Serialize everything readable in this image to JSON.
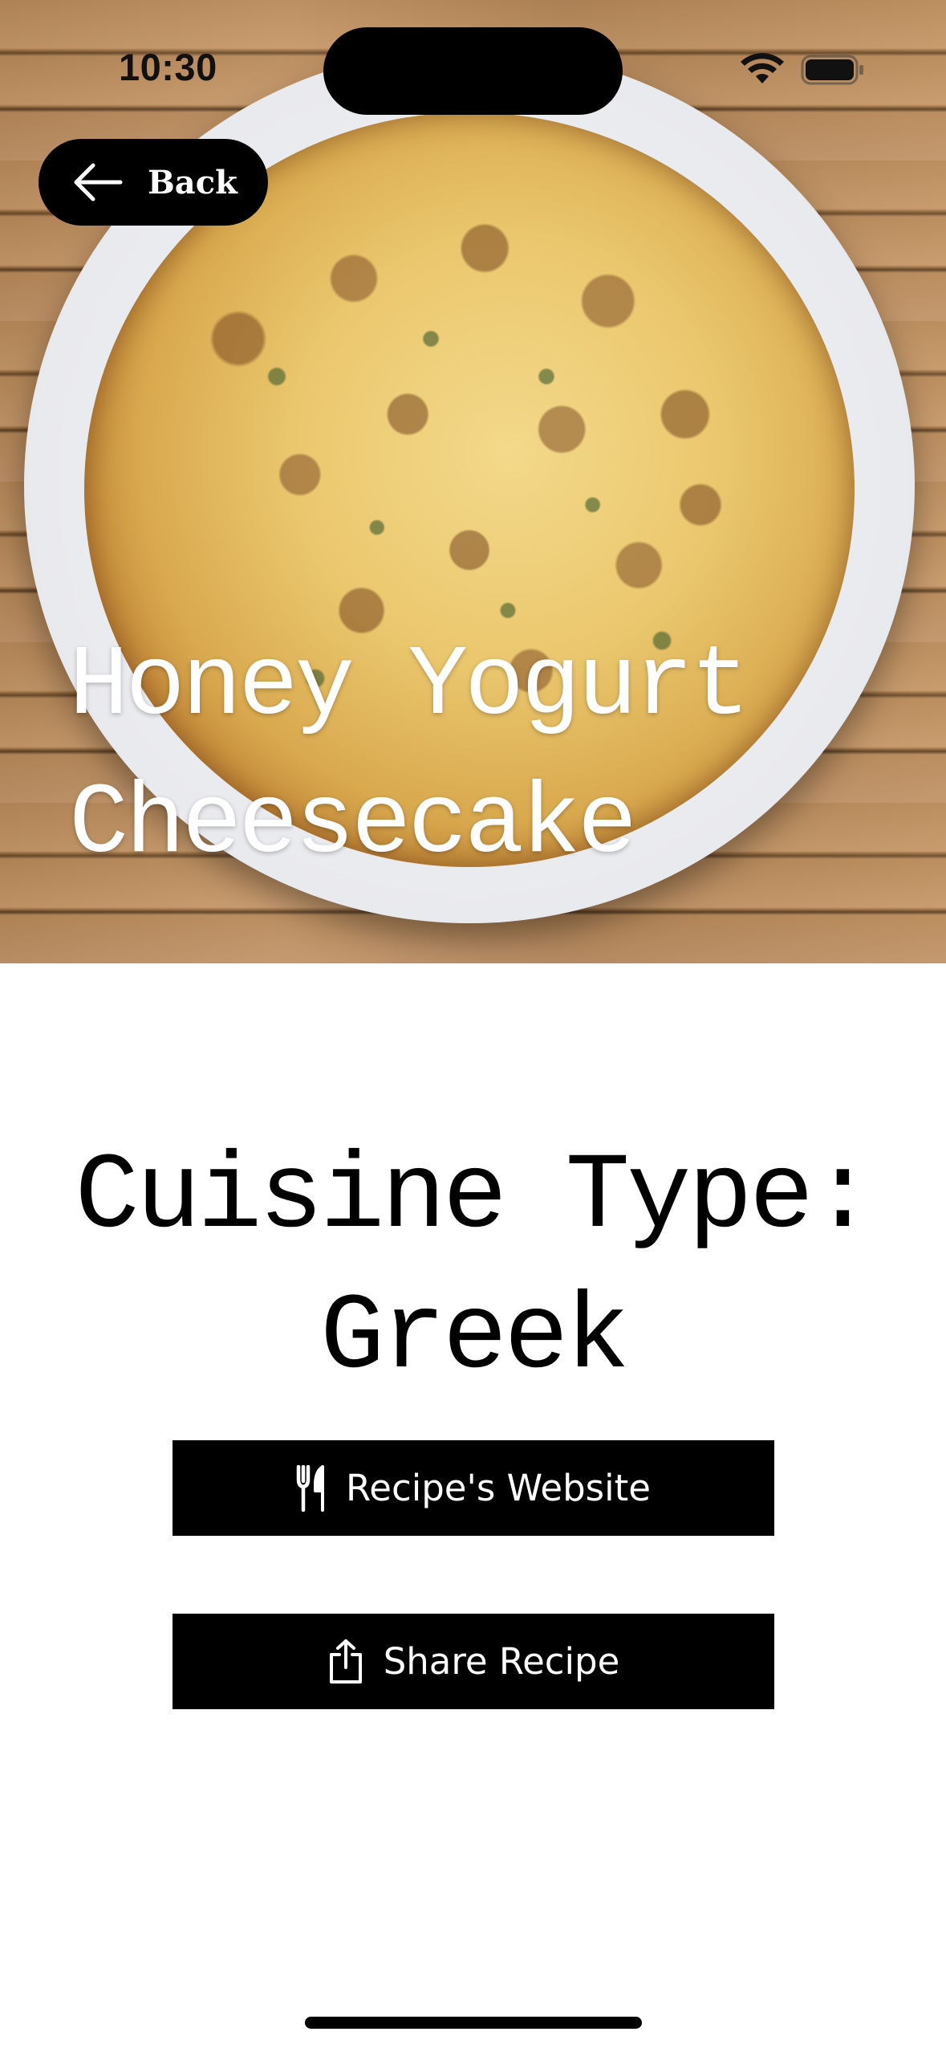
{
  "status_bar": {
    "time": "10:30"
  },
  "navigation": {
    "back_label": "Back"
  },
  "recipe": {
    "title": "Honey Yogurt Cheesecake",
    "cuisine_prefix": "Cuisine Type:",
    "cuisine": "Greek"
  },
  "actions": {
    "website_label": "Recipe's Website",
    "share_label": "Share Recipe"
  },
  "icons": {
    "back": "arrow-left-icon",
    "website": "fork-knife-icon",
    "share": "share-icon",
    "wifi": "wifi-icon",
    "battery": "battery-icon"
  },
  "colors": {
    "button_background": "#000000",
    "button_text": "#ffffff",
    "page_background": "#ffffff",
    "title_overlay_text": "#ffffff"
  }
}
